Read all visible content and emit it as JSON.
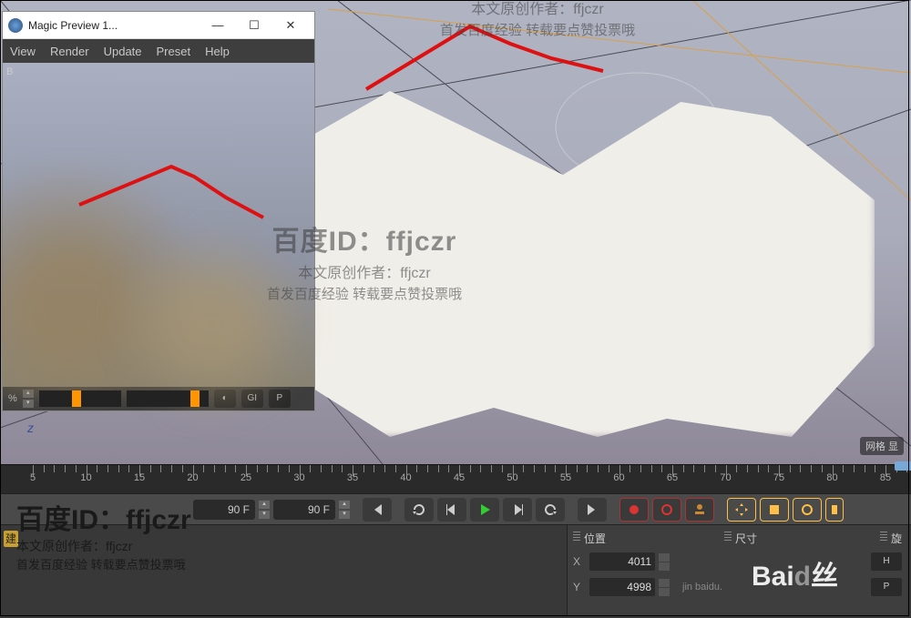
{
  "preview": {
    "title": "Magic Preview 1...",
    "menu": {
      "view": "View",
      "render": "Render",
      "update": "Update",
      "preset": "Preset",
      "help": "Help"
    },
    "percent_label": "%",
    "gi_label": "GI",
    "p_label": "P"
  },
  "viewport": {
    "axis": "z",
    "grid_badge": "网格 显"
  },
  "timeline": {
    "marks": [
      5,
      10,
      15,
      20,
      25,
      30,
      35,
      40,
      45,
      50,
      55,
      60,
      65,
      70,
      75,
      80,
      85
    ],
    "current_frame": "90 F",
    "end_frame": "90 F"
  },
  "coords": {
    "pos_label": "位置",
    "size_label": "尺寸",
    "rot_label": "旋",
    "x_label": "X",
    "y_label": "Y",
    "x_value": "4011",
    "y_value": "4998",
    "hint_h": "H",
    "hint_p": "P",
    "footer": "jin         baidu."
  },
  "watermarks": {
    "id_line": "百度ID：ffjczr",
    "author_line": "本文原创作者：ffjczr",
    "repost_line": "首发百度经验 转载要点赞投票哦",
    "baidu_logo_a": "Bai",
    "baidu_logo_b": "丝"
  },
  "yellow_tab": "建"
}
